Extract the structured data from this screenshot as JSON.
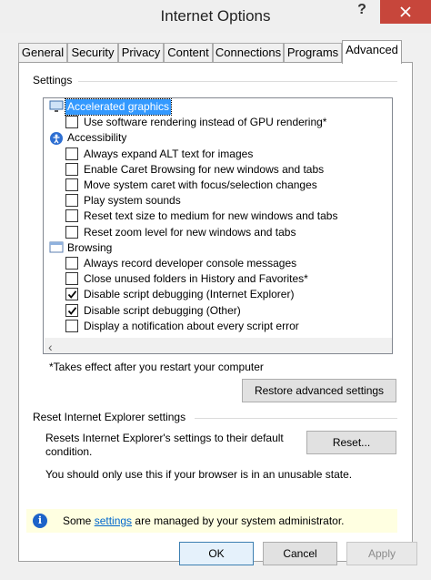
{
  "window": {
    "title": "Internet Options",
    "help_label": "?"
  },
  "tabs": [
    "General",
    "Security",
    "Privacy",
    "Content",
    "Connections",
    "Programs",
    "Advanced"
  ],
  "active_tab": "Advanced",
  "settings_group": {
    "label": "Settings",
    "rows": [
      {
        "kind": "category",
        "icon": "display-icon",
        "label": "Accelerated graphics",
        "selected": true
      },
      {
        "kind": "option",
        "label": "Use software rendering instead of GPU rendering*",
        "checked": false
      },
      {
        "kind": "category",
        "icon": "accessibility-icon",
        "label": "Accessibility"
      },
      {
        "kind": "option",
        "label": "Always expand ALT text for images",
        "checked": false
      },
      {
        "kind": "option",
        "label": "Enable Caret Browsing for new windows and tabs",
        "checked": false
      },
      {
        "kind": "option",
        "label": "Move system caret with focus/selection changes",
        "checked": false
      },
      {
        "kind": "option",
        "label": "Play system sounds",
        "checked": false
      },
      {
        "kind": "option",
        "label": "Reset text size to medium for new windows and tabs",
        "checked": false
      },
      {
        "kind": "option",
        "label": "Reset zoom level for new windows and tabs",
        "checked": false
      },
      {
        "kind": "category",
        "icon": "browsing-icon",
        "label": "Browsing"
      },
      {
        "kind": "option",
        "label": "Always record developer console messages",
        "checked": false
      },
      {
        "kind": "option",
        "label": "Close unused folders in History and Favorites*",
        "checked": false
      },
      {
        "kind": "option",
        "label": "Disable script debugging (Internet Explorer)",
        "checked": true
      },
      {
        "kind": "option",
        "label": "Disable script debugging (Other)",
        "checked": true
      },
      {
        "kind": "option",
        "label": "Display a notification about every script error",
        "checked": false
      }
    ],
    "footnote": "*Takes effect after you restart your computer",
    "restore_button": "Restore advanced settings"
  },
  "reset_group": {
    "label": "Reset Internet Explorer settings",
    "description": "Resets Internet Explorer's settings to their default condition.",
    "reset_button": "Reset...",
    "warning": "You should only use this if your browser is in an unusable state."
  },
  "info_bar": {
    "prefix": "Some",
    "link": "settings",
    "suffix": "are managed by your system administrator.",
    "icon": "info-icon"
  },
  "footer": {
    "ok": "OK",
    "cancel": "Cancel",
    "apply": "Apply"
  }
}
